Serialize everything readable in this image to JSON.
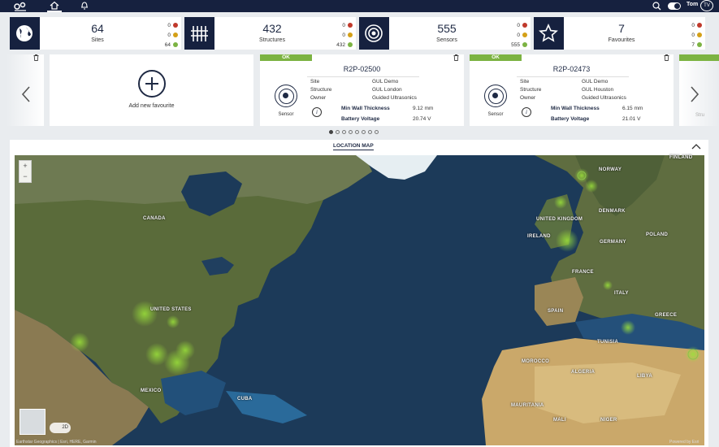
{
  "header": {
    "user_name": "Tom",
    "user_initials": "TV"
  },
  "stats": [
    {
      "value": "64",
      "label": "Sites",
      "icon": "globe-icon",
      "counts": [
        "0",
        "0",
        "64"
      ]
    },
    {
      "value": "432",
      "label": "Structures",
      "icon": "structure-icon",
      "counts": [
        "0",
        "0",
        "432"
      ]
    },
    {
      "value": "555",
      "label": "Sensors",
      "icon": "sensor-icon",
      "counts": [
        "0",
        "0",
        "555"
      ]
    },
    {
      "value": "7",
      "label": "Favourites",
      "icon": "star-icon",
      "counts": [
        "0",
        "0",
        "7"
      ]
    }
  ],
  "status_colors": {
    "red": "#c0392b",
    "amber": "#d4a017",
    "green": "#7cb342"
  },
  "favourites": {
    "add_label": "Add new favourite",
    "edge_right_text": "Stru",
    "cards": [
      {
        "status": "OK",
        "title": "R2P-02500",
        "sensor_label": "Sensor",
        "site_key": "Site",
        "site": "GUL Demo",
        "structure_key": "Structure",
        "structure": "GUL London",
        "owner_key": "Owner",
        "owner": "Guided Ultrasonics",
        "thickness_key": "Min Wall Thickness",
        "thickness": "9.12 mm",
        "battery_key": "Battery Voltage",
        "battery": "20.74 V"
      },
      {
        "status": "OK",
        "title": "R2P-02473",
        "sensor_label": "Sensor",
        "site_key": "Site",
        "site": "GUL Demo",
        "structure_key": "Structure",
        "structure": "GUL Houston",
        "owner_key": "Owner",
        "owner": "Guided Ultrasonics",
        "thickness_key": "Min Wall Thickness",
        "thickness": "6.15 mm",
        "battery_key": "Battery Voltage",
        "battery": "21.01 V"
      }
    ],
    "page_count": 8,
    "active_page": 1
  },
  "map": {
    "title": "LOCATION MAP",
    "view_toggle": "2D",
    "attribution_left": "Earthstar Geographics | Esri, HERE, Garmin",
    "attribution_right": "Powered by Esri",
    "labels": {
      "canada": "CANADA",
      "united_states": "UNITED STATES",
      "mexico": "MEXICO",
      "united_kingdom": "UNITED KINGDOM",
      "ireland": "IRELAND",
      "france": "FRANCE",
      "spain": "SPAIN",
      "germany": "GERMANY",
      "norway": "NORWAY",
      "finland": "FINLAND",
      "denmark": "DENMARK",
      "poland": "POLAND",
      "italy": "ITALY",
      "greece": "GREECE",
      "morocco": "MOROCCO",
      "algeria": "ALGERIA",
      "libya": "LIBYA",
      "mauritania": "MAURITANIA",
      "mali": "MALI",
      "niger": "NIGER",
      "cuba": "CUBA",
      "tunisia": "TUNISIA"
    }
  }
}
